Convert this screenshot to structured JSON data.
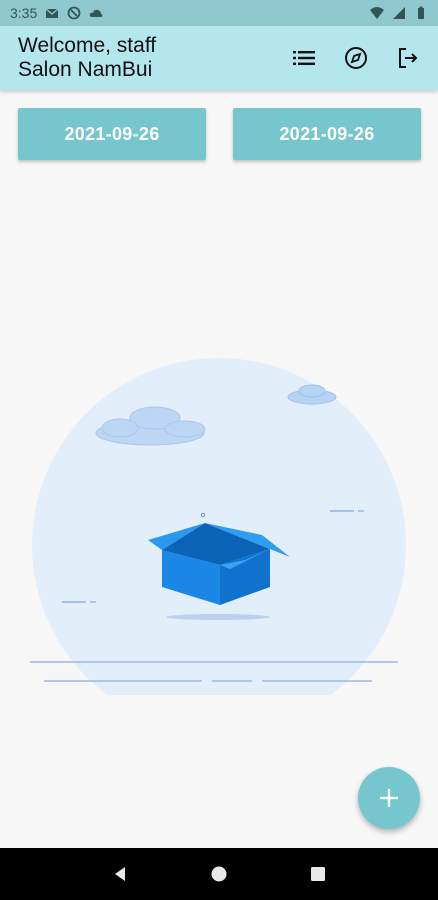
{
  "status_bar": {
    "time": "3:35",
    "icons": [
      "gmail-icon",
      "sync-icon",
      "cloud-icon",
      "wifi-icon",
      "signal-icon",
      "battery-icon"
    ]
  },
  "app_bar": {
    "title_line1": "Welcome, staff",
    "title_line2": "Salon NamBui",
    "actions": [
      "list-icon",
      "compass-icon",
      "logout-icon"
    ]
  },
  "date_range": {
    "from": "2021-09-26",
    "to": "2021-09-26"
  },
  "fab": {
    "icon": "plus-icon"
  },
  "nav": {
    "icons": [
      "back-icon",
      "home-icon",
      "recents-icon"
    ]
  },
  "colors": {
    "status_bar": "#8fc9cf",
    "app_bar": "#b4e6ee",
    "accent": "#76c6cd",
    "box": "#1a86e6"
  }
}
